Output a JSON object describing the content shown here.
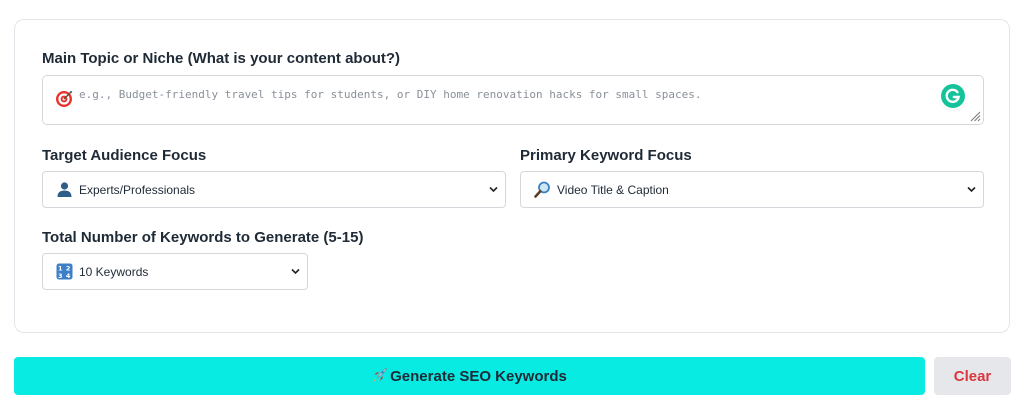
{
  "form": {
    "topic_label": "Main Topic or Niche (What is your content about?)",
    "topic_placeholder": "e.g., Budget-friendly travel tips for students, or DIY home renovation hacks for small spaces.",
    "topic_icon": "target-icon",
    "audience_label": "Target Audience Focus",
    "audience_value": "Experts/Professionals",
    "audience_icon": "person-icon",
    "keyword_focus_label": "Primary Keyword Focus",
    "keyword_focus_value": "Video Title & Caption",
    "keyword_focus_icon": "magnifier-icon",
    "count_label": "Total Number of Keywords to Generate (5-15)",
    "count_value": "10 Keywords",
    "count_icon": "numbers-icon"
  },
  "actions": {
    "generate_label": "Generate SEO Keywords",
    "clear_label": "Clear"
  },
  "colors": {
    "generate_bg": "#08ebe3",
    "clear_bg": "#e5e7eb",
    "clear_text": "#d9363e",
    "grammarly": "#15c39a"
  }
}
